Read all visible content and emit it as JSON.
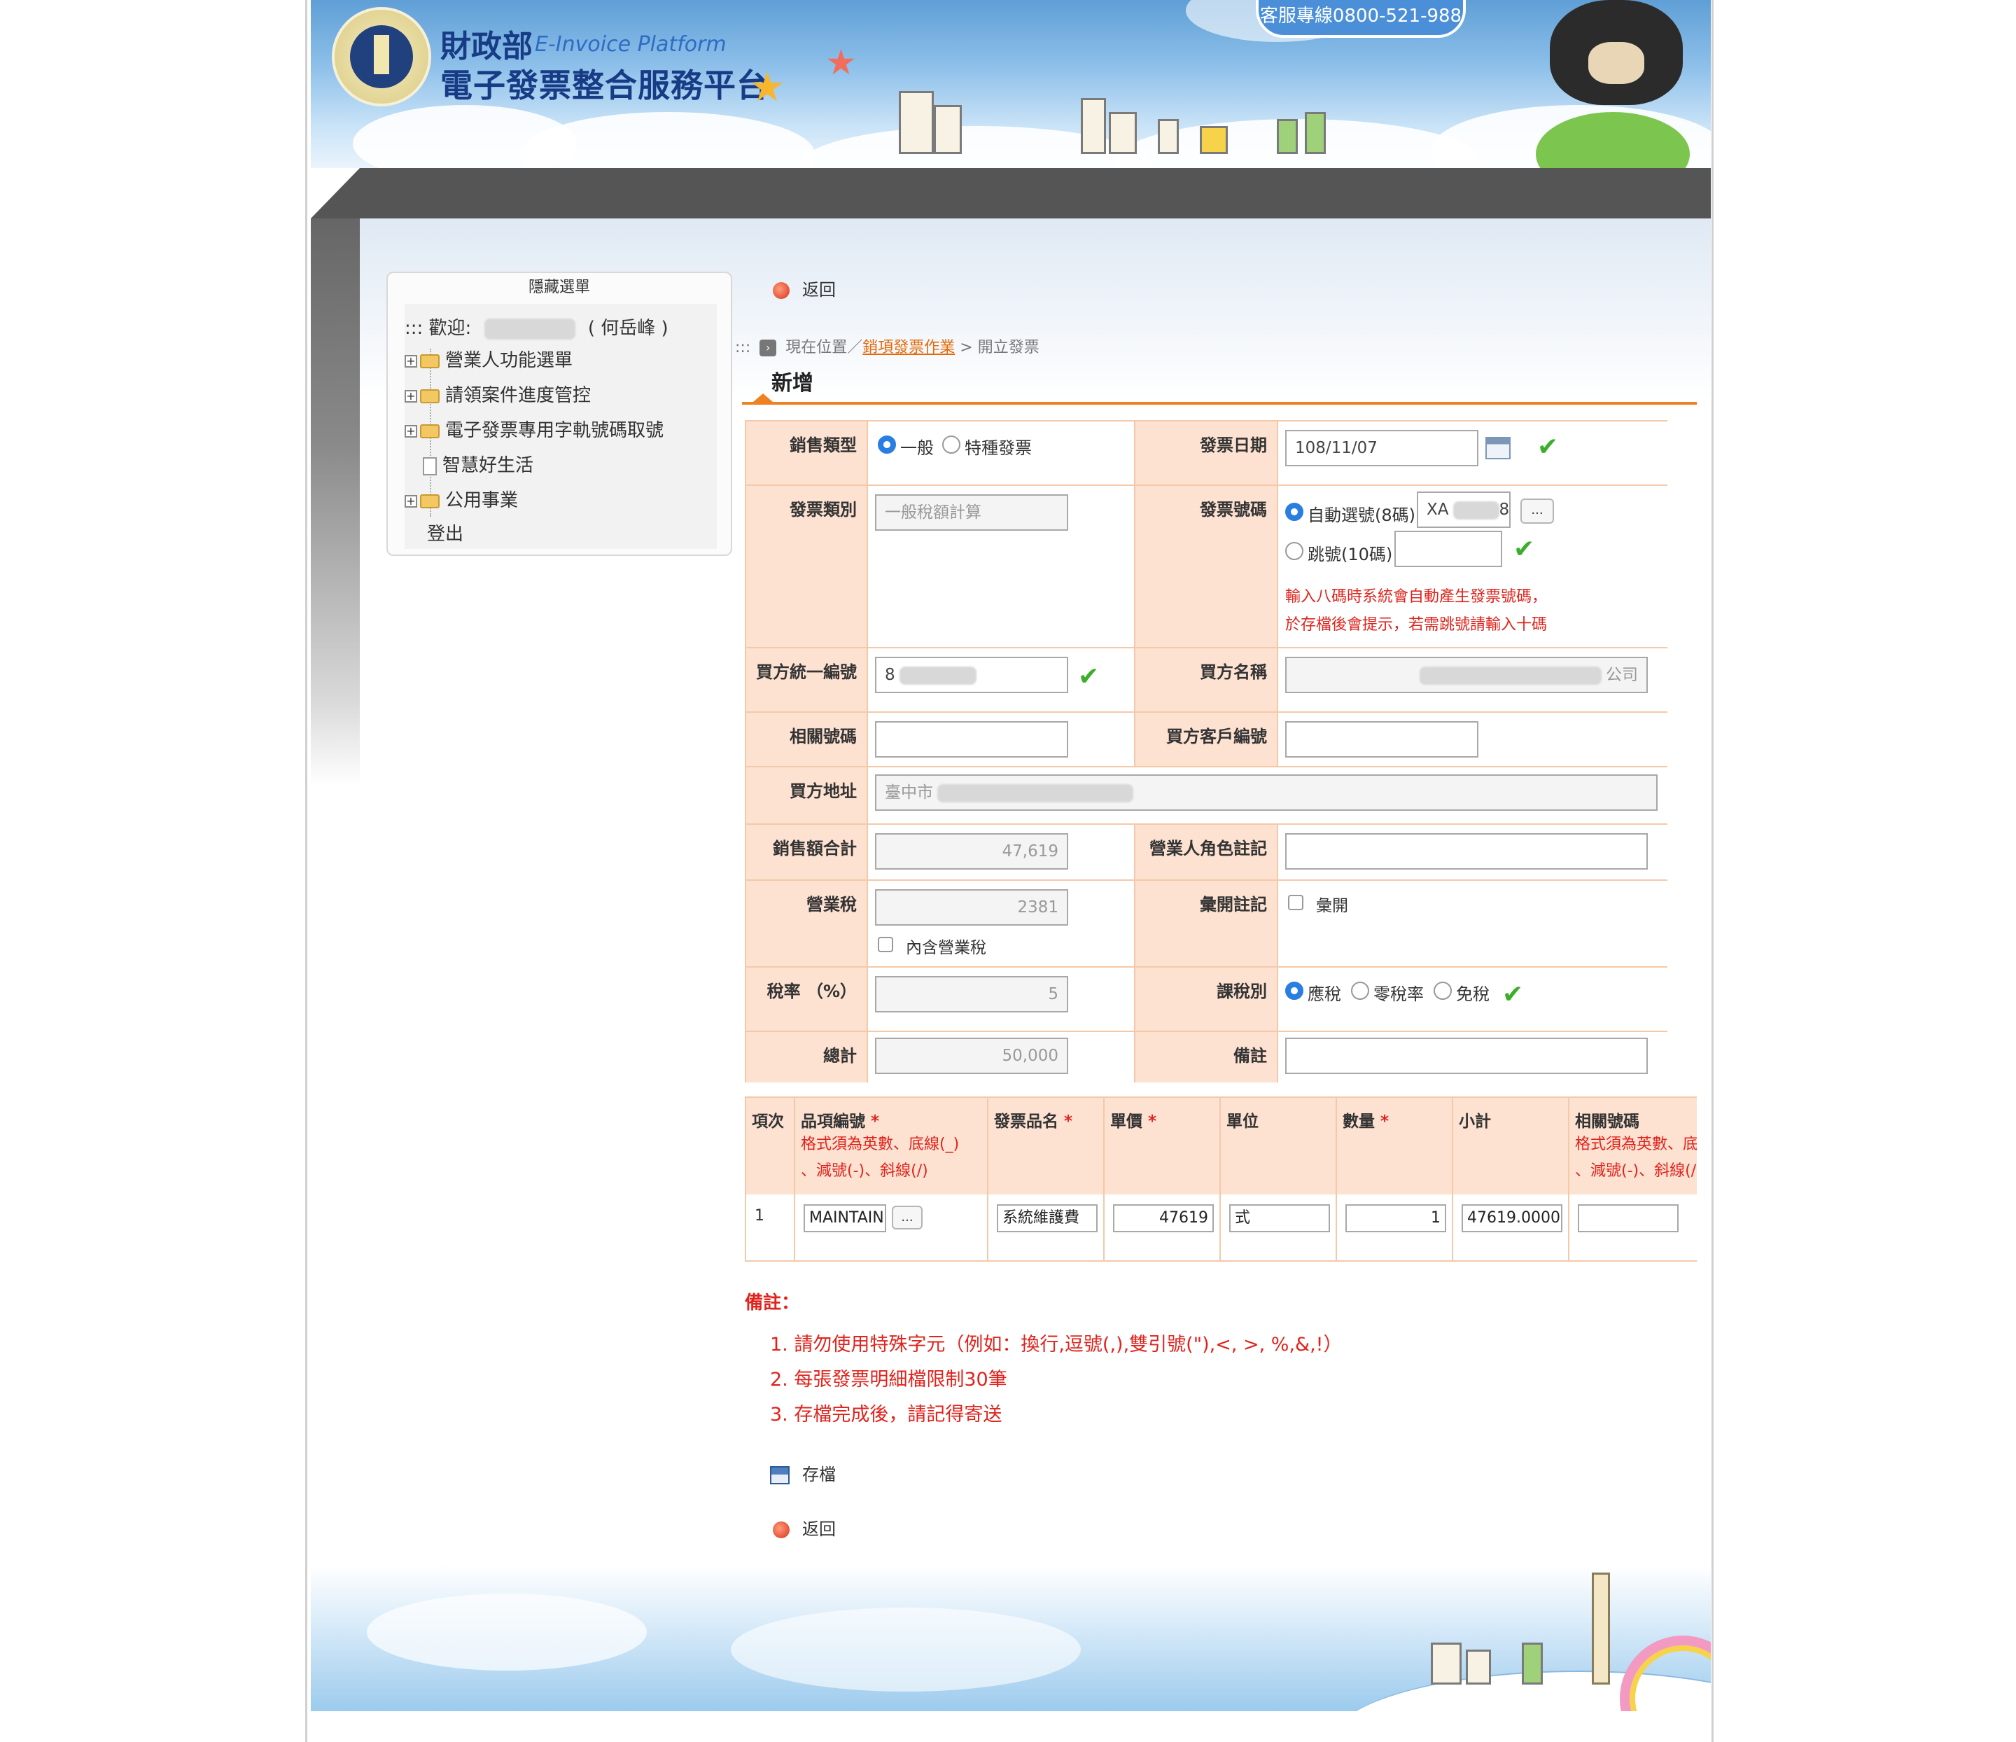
{
  "header": {
    "brand_ministry": "財政部",
    "brand_english": "E-Invoice Platform",
    "brand_platform": "電子發票整合服務平台",
    "hotline": "客服專線0800-521-988"
  },
  "sidebar": {
    "title": "隱藏選單",
    "welcome_prefix": "::: 歡迎:",
    "welcome_name": "( 何岳峰 )",
    "items": [
      {
        "label": "營業人功能選單",
        "icon": "folder-icon"
      },
      {
        "label": "請領案件進度管控",
        "icon": "folder-icon"
      },
      {
        "label": "電子發票專用字軌號碼取號",
        "icon": "folder-icon"
      },
      {
        "label": "智慧好生活",
        "icon": "document-icon"
      },
      {
        "label": "公用事業",
        "icon": "folder-icon"
      },
      {
        "label": "登出",
        "icon": ""
      }
    ]
  },
  "nav": {
    "back_top": "返回",
    "back_bottom": "返回",
    "breadcrumb_prefix": ":::",
    "breadcrumb_location": "現在位置／",
    "breadcrumb_link": "銷項發票作業",
    "breadcrumb_sep": ">",
    "breadcrumb_current": "開立發票",
    "page_title": "新增"
  },
  "form": {
    "sales_type_label": "銷售類型",
    "sales_type_options": [
      "一般",
      "特種發票"
    ],
    "sales_type_selected": "一般",
    "invoice_date_label": "發票日期",
    "invoice_date_value": "108/11/07",
    "invoice_category_label": "發票類別",
    "invoice_category_placeholder": "一般稅額計算",
    "invoice_number_label": "發票號碼",
    "auto_number_label": "自動選號(8碼)",
    "auto_number_prefix": "XA",
    "auto_number_suffix": "8",
    "skip_number_label": "跳號(10碼)",
    "number_hint_1": "輸入八碼時系統會自動產生發票號碼，",
    "number_hint_2": "於存檔後會提示，若需跳號請輸入十碼",
    "buyer_id_label": "買方統一編號",
    "buyer_id_value": "8",
    "buyer_name_label": "買方名稱",
    "buyer_name_suffix": "公司",
    "related_number_label": "相關號碼",
    "buyer_customer_no_label": "買方客戶編號",
    "buyer_address_label": "買方地址",
    "buyer_address_value": "臺中市",
    "sales_total_label": "銷售額合計",
    "sales_total_value": "47,619",
    "business_role_label": "營業人角色註記",
    "tax_label": "營業稅",
    "tax_value": "2381",
    "tax_included_label": "內含營業稅",
    "consolidated_label": "彙開註記",
    "consolidated_option": "彙開",
    "tax_rate_label": "稅率 （%）",
    "tax_rate_value": "5",
    "tax_type_label": "課稅別",
    "tax_type_options": [
      "應稅",
      "零稅率",
      "免稅"
    ],
    "tax_type_selected": "應稅",
    "grand_total_label": "總計",
    "grand_total_value": "50,000",
    "remark_label": "備註",
    "dots_label": "..."
  },
  "detail": {
    "headers": {
      "seq": "項次",
      "item_code": "品項編號",
      "item_name": "發票品名",
      "unit_price": "單價",
      "unit": "單位",
      "quantity": "數量",
      "subtotal": "小計",
      "related_number": "相關號碼"
    },
    "required_mark": "*",
    "format_hint_1": "格式須為英數、底線(_)",
    "format_hint_2": "、減號(-)、斜線(/)",
    "format_hint_related_1": "格式須為英數、底線(_)",
    "format_hint_related_2": "、減號(-)、斜線(/)",
    "rows": [
      {
        "seq": "1",
        "item_code": "MAINTAIN",
        "item_name": "系統維護費",
        "unit_price": "47619",
        "unit": "式",
        "quantity": "1",
        "subtotal": "47619.0000",
        "related_number": ""
      }
    ]
  },
  "notes": {
    "title": "備註：",
    "items": [
      "1. 請勿使用特殊字元（例如：換行,逗號(,),雙引號(\"),<, >, %,&,!）",
      "2. 每張發票明細檔限制30筆",
      "3. 存檔完成後，請記得寄送"
    ]
  },
  "actions": {
    "save_label": "存檔"
  },
  "colors": {
    "accent_orange": "#f08020",
    "label_bg": "#fde2d2",
    "warning_red": "#e0231c",
    "check_green": "#3bae2a",
    "radio_blue": "#2a7de1"
  }
}
